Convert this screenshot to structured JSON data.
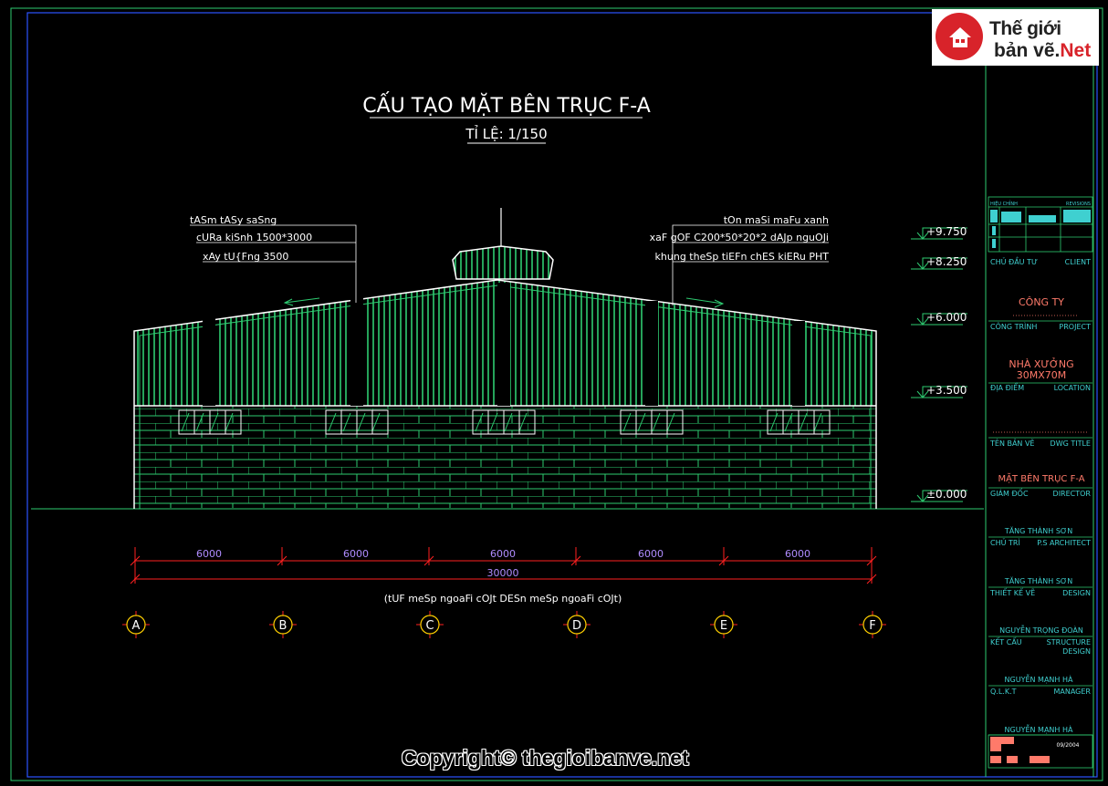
{
  "drawing": {
    "title": "CẤU TẠO MẶT BÊN TRỤC F-A",
    "scale": "TỈ LỆ: 1/150",
    "left_notes": [
      "tASm tASy saSng",
      "cURa kiSnh 1500*3000",
      "xAy tU{Fng 3500"
    ],
    "right_notes": [
      "tOn maSi maFu xanh",
      "xaF gOF C200*50*20*2 dAJp nguOJi",
      "khung theSp tiEFn chES kiERu PHT"
    ],
    "levels": [
      "+9.750",
      "+8.250",
      "+6.000",
      "+3.500",
      "±0.000"
    ],
    "spans": [
      "6000",
      "6000",
      "6000",
      "6000",
      "6000"
    ],
    "total": "30000",
    "note": "(tUF meSp ngoaFi cOJt DESn meSp ngoaFi cOJt)",
    "axes": [
      "A",
      "B",
      "C",
      "D",
      "E",
      "F"
    ]
  },
  "title_block": {
    "revision_left": "HIỆU CHỈNH",
    "revision_right": "REVISIONS",
    "client_vi": "CHỦ ĐẦU TƯ",
    "client_en": "CLIENT",
    "client_name": "CÔNG TY",
    "project_vi": "CÔNG TRÌNH",
    "project_en": "PROJECT",
    "project_name_1": "NHÀ XƯỞNG",
    "project_name_2": "30MX70M",
    "location_vi": "ĐỊA ĐIỂM",
    "location_en": "LOCATION",
    "dwg_title_vi": "TÊN BẢN VẼ",
    "dwg_title_en": "DWG TITLE",
    "dwg_title": "MẶT BÊN TRỤC F-A",
    "director_vi": "GIÁM ĐỐC",
    "director_en": "DIRECTOR",
    "director_name": "TĂNG THÀNH SƠN",
    "chief_vi": "CHỦ TRÌ",
    "chief_en": "P.S ARCHITECT",
    "chief_name": "TĂNG THÀNH SƠN",
    "design_vi": "THIẾT KẾ VẼ",
    "design_en": "DESIGN",
    "design_name": "NGUYỄN TRỌNG ĐOÀN",
    "struct_vi": "KẾT CẤU",
    "struct_en_1": "STRUCTURE",
    "struct_en_2": "DESIGN",
    "struct_name": "NGUYỄN MẠNH HÀ",
    "manager_vi": "Q.L.K.T",
    "manager_en": "MANAGER",
    "manager_name": "NGUYỄN MẠNH HÀ",
    "date": "09/2004"
  },
  "logo": {
    "line1": "Thế giới",
    "line2a": "bản vẽ.",
    "line2b": "Net"
  },
  "copyright": "Copyright© thegioibanve.net",
  "colors": {
    "green": "#2ecc71",
    "cyan": "#3fd0d0",
    "red": "#ff2020",
    "violet": "#b08cff",
    "yellow": "#ffd000",
    "salmon": "#ff7a6a"
  }
}
